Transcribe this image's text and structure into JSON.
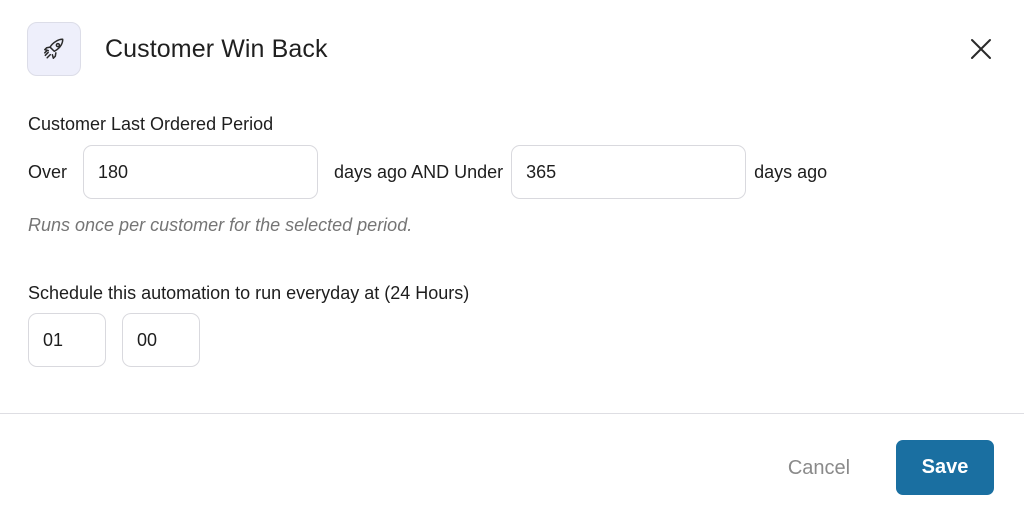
{
  "dialog": {
    "title": "Customer Win Back",
    "header_icon": "rocket-icon",
    "close_icon": "close-icon"
  },
  "period": {
    "label": "Customer Last Ordered Period",
    "prefix_text": "Over",
    "over_value": "180",
    "middle_text": "days ago AND Under",
    "under_value": "365",
    "suffix_text": "days ago",
    "help_text": "Runs once per customer for the selected period."
  },
  "schedule": {
    "label": "Schedule this automation to run everyday at (24 Hours)",
    "hour_value": "01",
    "minute_value": "00"
  },
  "footer": {
    "cancel_label": "Cancel",
    "save_label": "Save"
  },
  "colors": {
    "accent": "#1a6fa1",
    "icon_bg": "#eeeffb",
    "muted_text": "#757575"
  }
}
